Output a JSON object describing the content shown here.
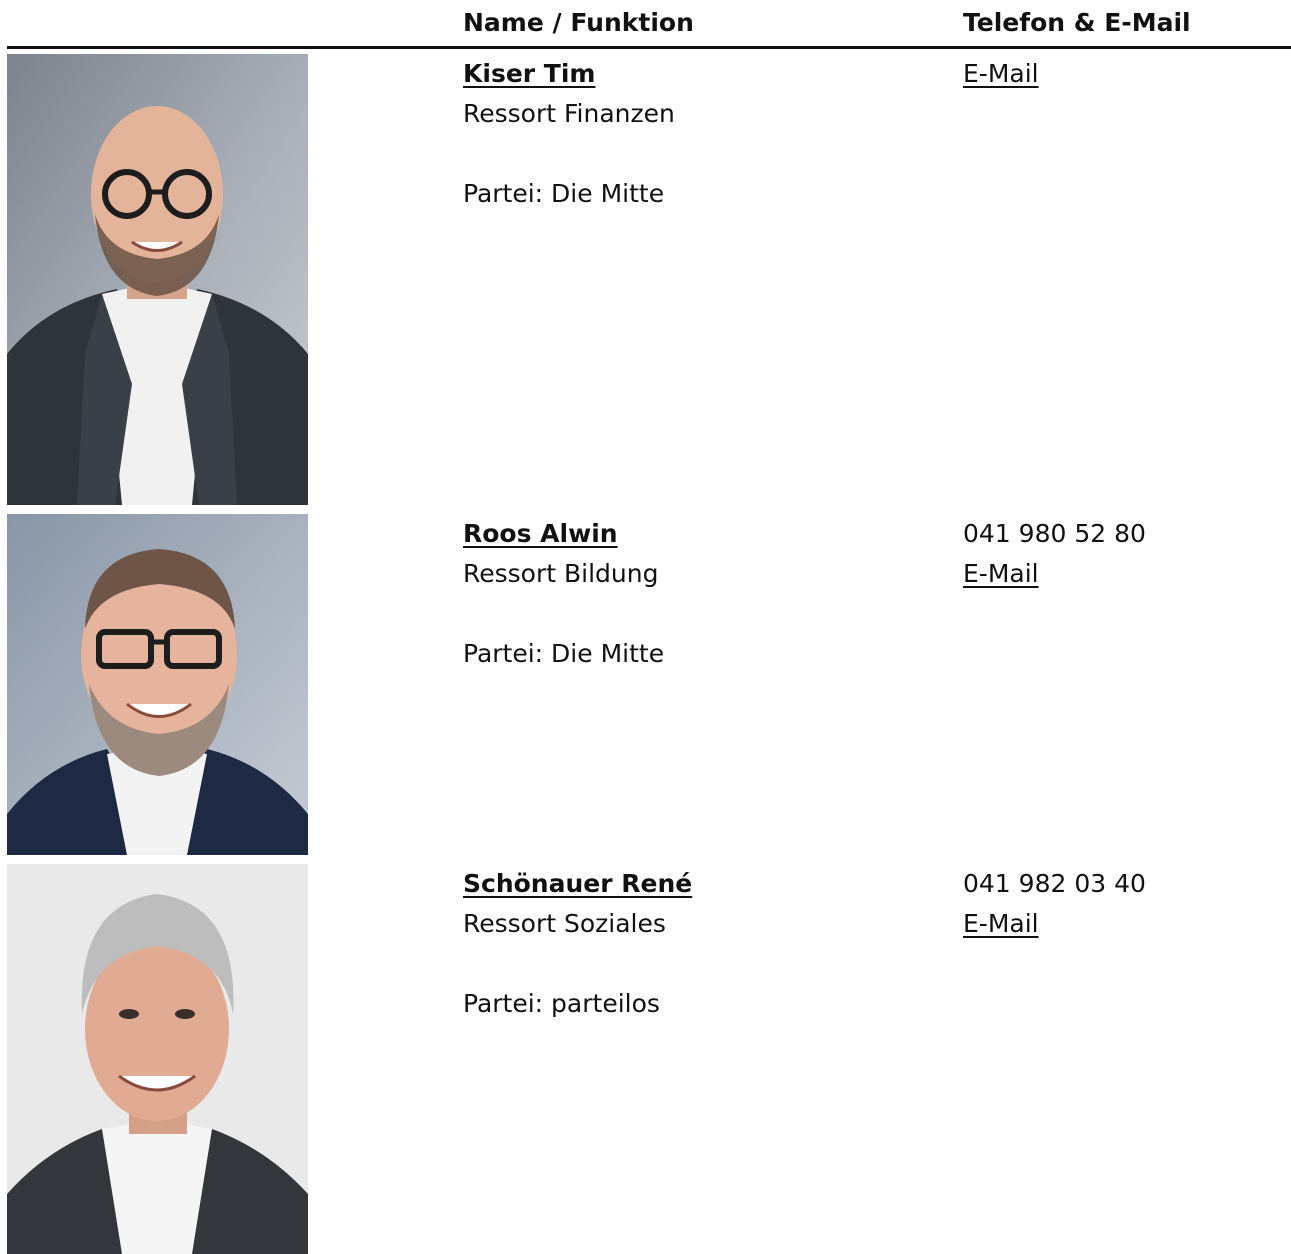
{
  "header": {
    "name_col": "Name / Funktion",
    "contact_col": "Telefon & E-Mail"
  },
  "people": [
    {
      "name": "Kiser Tim",
      "role": "Ressort Finanzen",
      "party": "Partei: Die Mitte",
      "phone": null,
      "email_label": "E-Mail"
    },
    {
      "name": "Roos Alwin",
      "role": "Ressort Bildung",
      "party": "Partei: Die Mitte",
      "phone": "041 980 52 80",
      "email_label": "E-Mail"
    },
    {
      "name": "Schönauer René",
      "role": "Ressort Soziales",
      "party": "Partei: parteilos",
      "phone": "041 982 03 40",
      "email_label": "E-Mail"
    }
  ]
}
